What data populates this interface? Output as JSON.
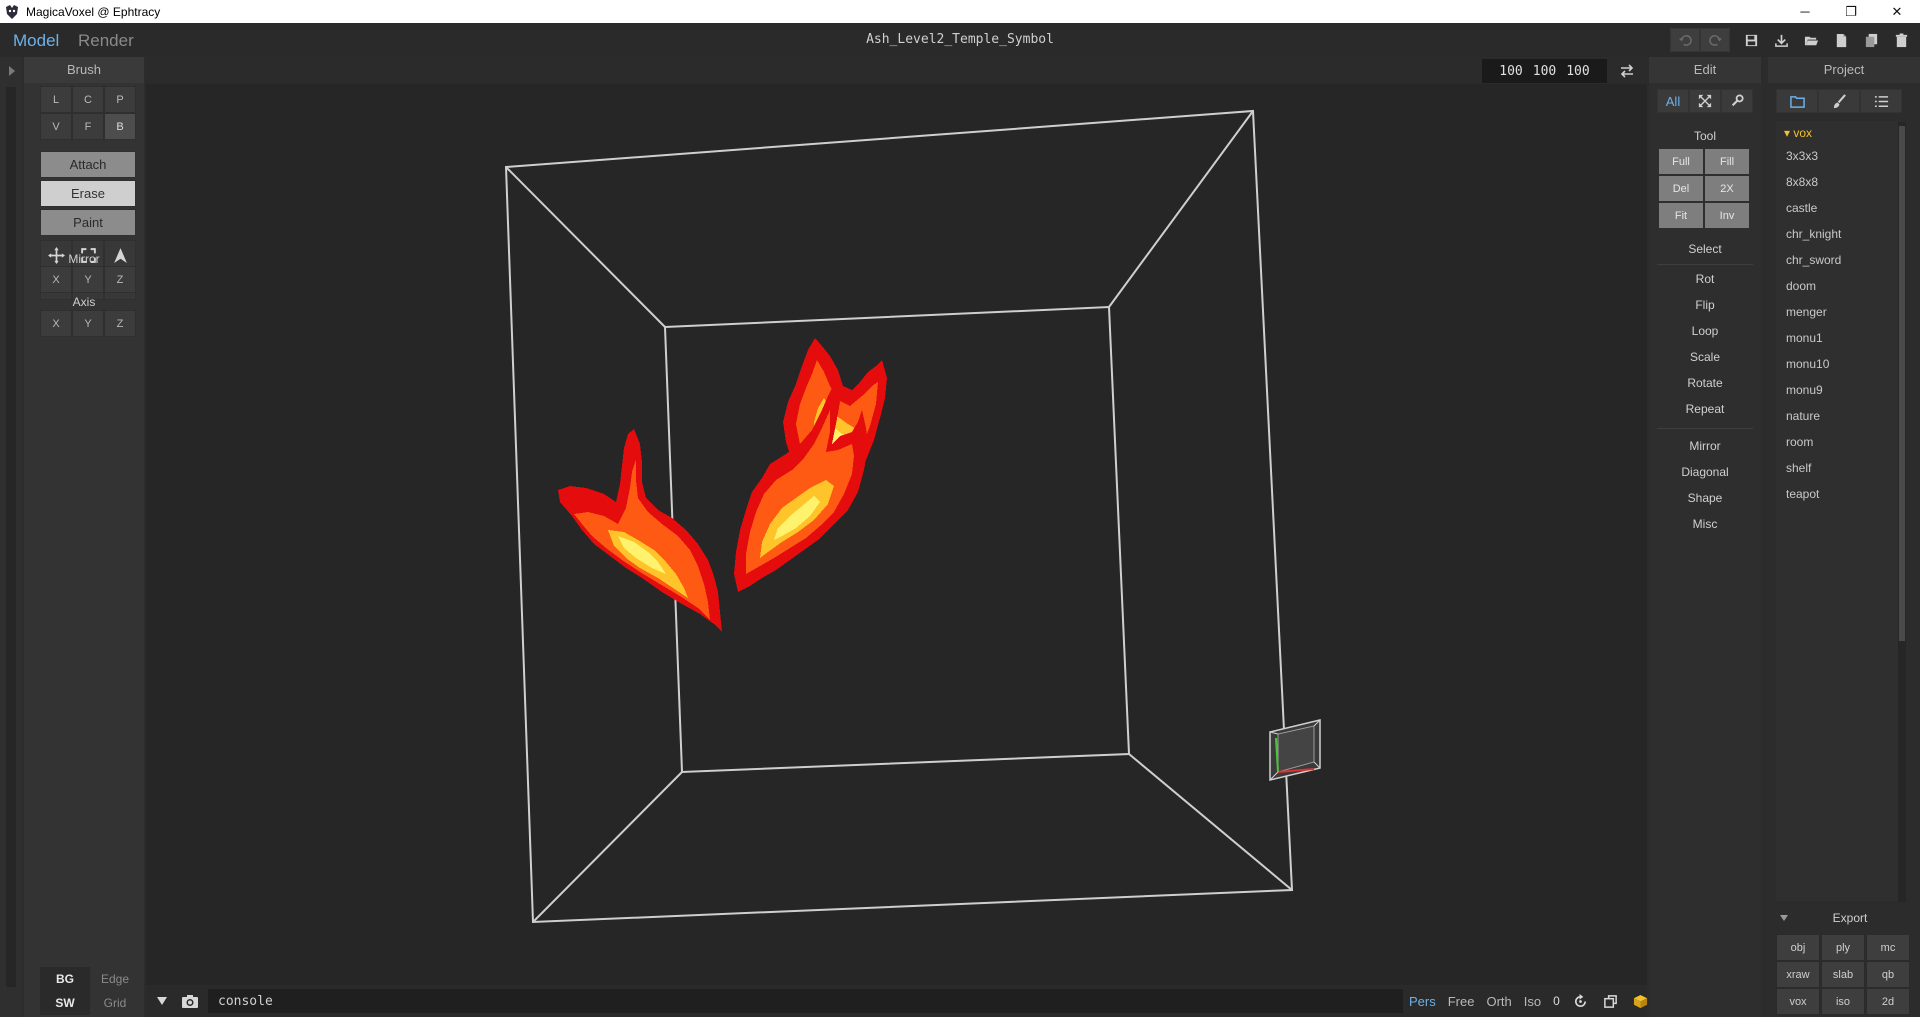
{
  "window": {
    "title": "MagicaVoxel @ Ephtracy",
    "minimize": "─",
    "maximize": "❐",
    "close": "✕"
  },
  "header": {
    "tabs": [
      "Model",
      "Render"
    ],
    "project_title": "Ash_Level2_Temple_Symbol"
  },
  "brush": {
    "title": "Brush",
    "types": [
      "L",
      "C",
      "P",
      "V",
      "F",
      "B"
    ],
    "selected_type": "B",
    "modes": [
      "Attach",
      "Erase",
      "Paint"
    ],
    "selected_mode": "Erase",
    "tools": [
      "move-icon",
      "select-box-icon",
      "cursor-icon",
      "picker-icon",
      "trash-icon",
      "bucket-icon"
    ],
    "mirror_label": "Mirror",
    "mirror_axes": [
      "X",
      "Y",
      "Z"
    ],
    "axis_label": "Axis",
    "axis_axes": [
      "X",
      "Y",
      "Z"
    ],
    "toggles": [
      [
        "BG",
        "Edge"
      ],
      [
        "SW",
        "Grid"
      ]
    ]
  },
  "viewport": {
    "dims": [
      "100",
      "100",
      "100"
    ],
    "console_placeholder": "console",
    "console_value": "console",
    "view_modes": [
      "Pers",
      "Free",
      "Orth",
      "Iso"
    ],
    "active_view": "Pers",
    "view_value": "0"
  },
  "edit": {
    "title": "Edit",
    "tabs": [
      "All"
    ],
    "tool_label": "Tool",
    "tool_buttons": [
      "Full",
      "Fill",
      "Del",
      "2X",
      "Fit",
      "Inv"
    ],
    "select_label": "Select",
    "commands_1": [
      "Rot",
      "Flip",
      "Loop",
      "Scale",
      "Rotate",
      "Repeat"
    ],
    "commands_2": [
      "Mirror",
      "Diagonal",
      "Shape",
      "Misc"
    ]
  },
  "project": {
    "title": "Project",
    "folder": "vox",
    "files": [
      "3x3x3",
      "8x8x8",
      "castle",
      "chr_knight",
      "chr_sword",
      "doom",
      "menger",
      "monu1",
      "monu10",
      "monu9",
      "nature",
      "room",
      "shelf",
      "teapot"
    ],
    "export_label": "Export",
    "export_formats": [
      "obj",
      "ply",
      "mc",
      "xraw",
      "slab",
      "qb",
      "vox",
      "iso",
      "2d"
    ]
  },
  "colors": {
    "accent": "#6db1e8",
    "folder": "#f3c12b",
    "flame_outer": "#e40c0c",
    "flame_mid": "#ff5a14",
    "flame_inner": "#ffc42a",
    "flame_core": "#fff36e"
  }
}
